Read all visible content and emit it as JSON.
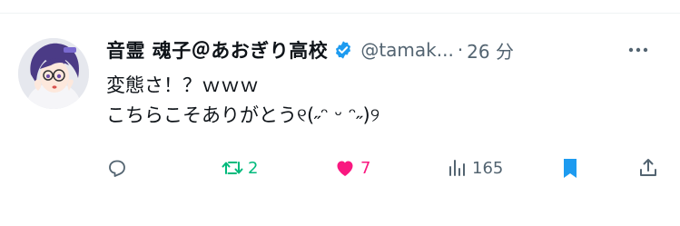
{
  "tweet": {
    "display_name": "音霊 魂子＠あおぎり高校",
    "handle": "@tamak...",
    "separator": "·",
    "time": "26 分",
    "lines": [
      "変態さ！？ｗｗｗ",
      "こちらこそありがとう୧(˶ᵔ ᵕ ᵔ˶)୨"
    ]
  },
  "actions": {
    "reply_count": "",
    "retweet_count": "2",
    "like_count": "7",
    "view_count": "165"
  },
  "colors": {
    "verified": "#1d9bf0",
    "retweet": "#00ba7c",
    "like": "#f91880",
    "bookmark": "#1d9bf0",
    "secondary_text": "#536471"
  },
  "icons": [
    "more-icon",
    "verified-badge-icon",
    "reply-icon",
    "retweet-icon",
    "like-icon",
    "views-icon",
    "bookmark-icon",
    "share-icon"
  ]
}
